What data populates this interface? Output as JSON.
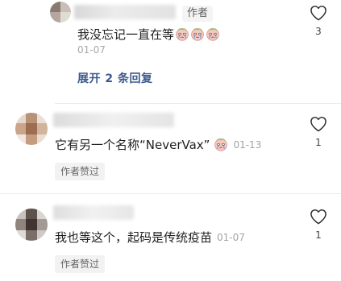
{
  "reply": {
    "author_tag": "作者",
    "text": "我没忘记一直在等",
    "emoji_count": 3,
    "date": "01-07",
    "likes": "3",
    "expand_label": "展开 2 条回复"
  },
  "comments": [
    {
      "text": "它有另一个名称“NeverVax”",
      "has_emoji": true,
      "date": "01-13",
      "likes": "1",
      "badge": "作者赞过"
    },
    {
      "text": "我也等这个，起码是传统疫苗",
      "has_emoji": false,
      "date": "01-07",
      "likes": "1",
      "badge": "作者赞过"
    }
  ],
  "colors": {
    "expand_link": "#3c5a8c",
    "date": "#a8a8a8",
    "badge_bg": "#f2f2f2"
  },
  "icons": {
    "like": "heart-outline-icon",
    "emoji": "crying-face-emoji-icon"
  }
}
